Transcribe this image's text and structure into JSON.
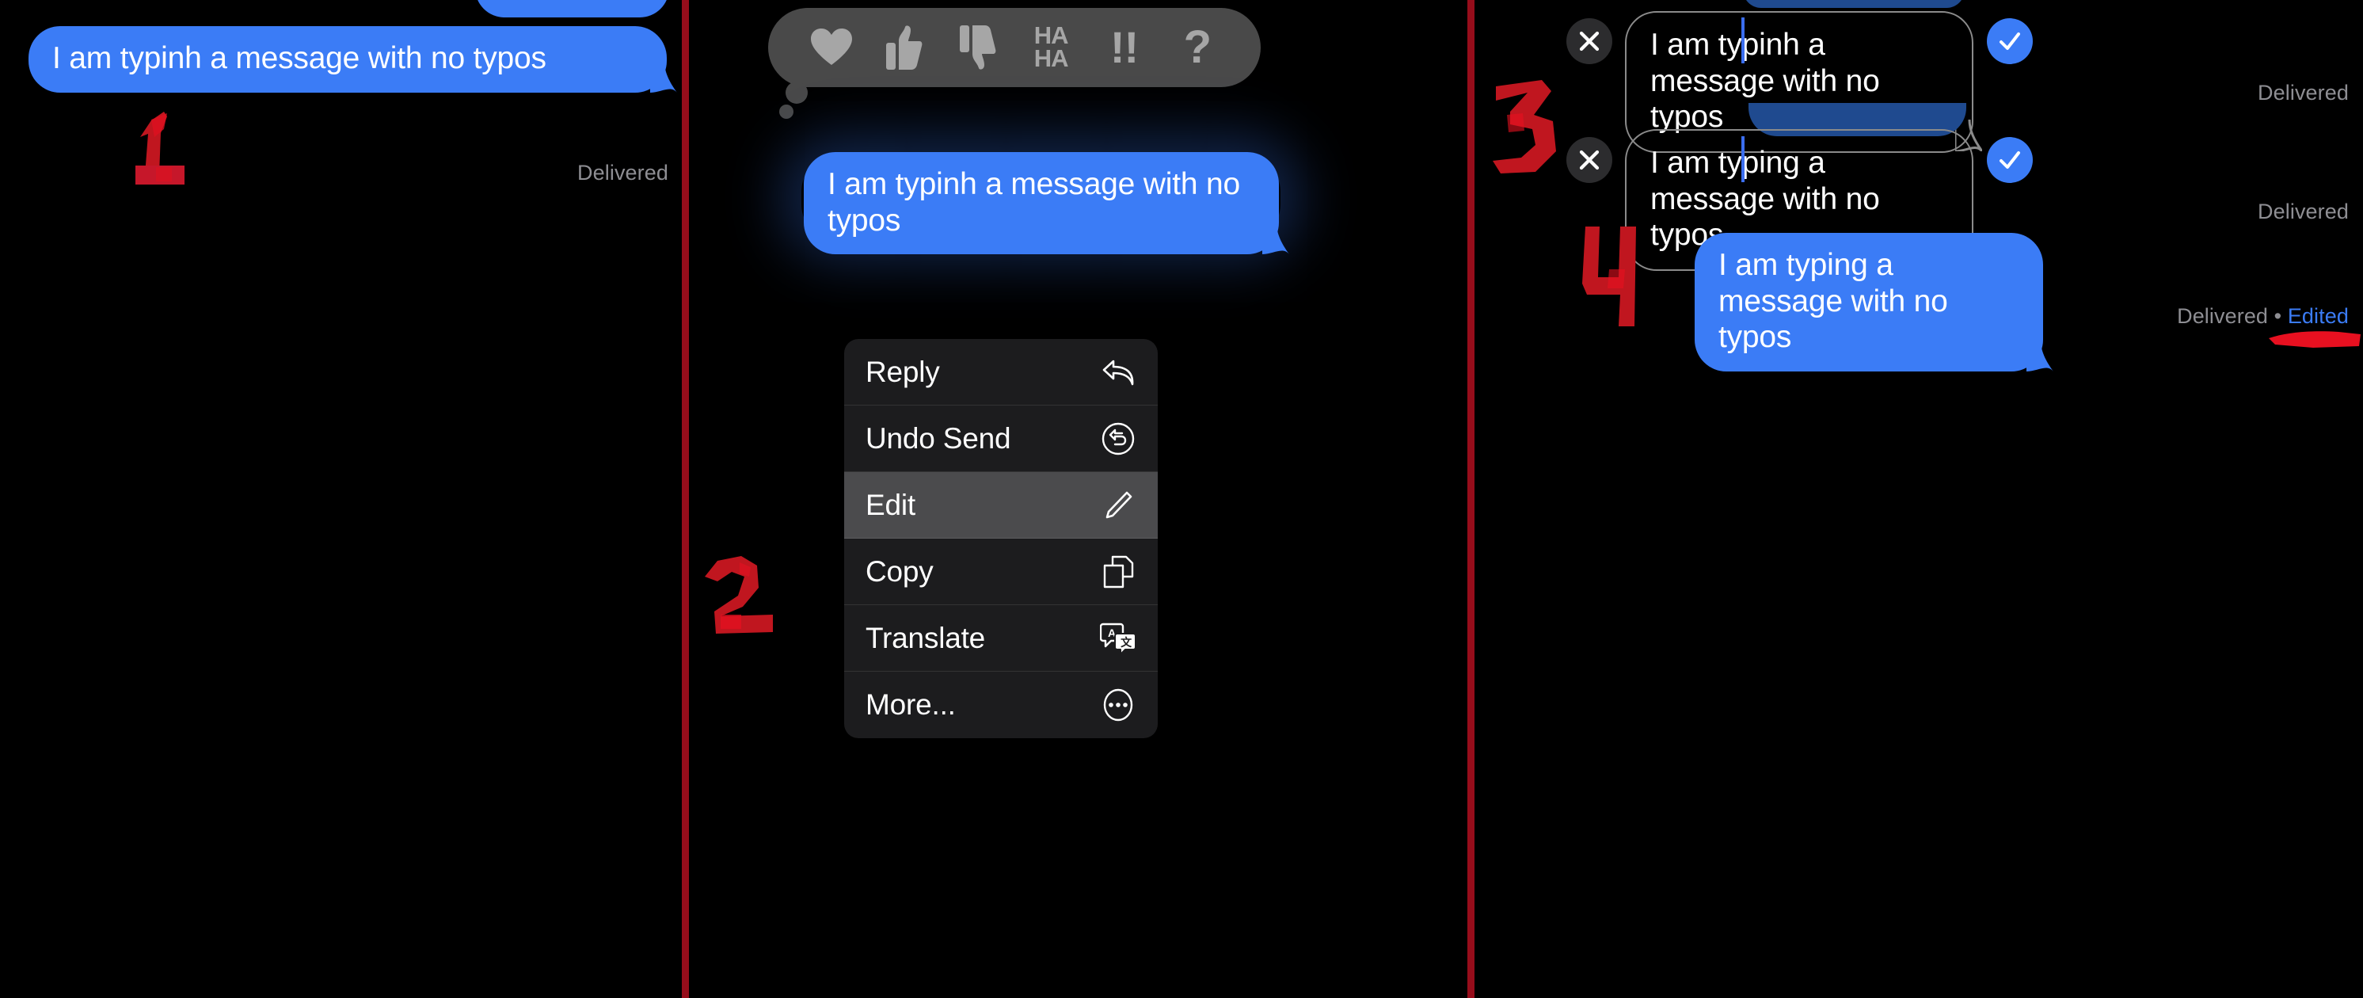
{
  "app": "iOS Messages",
  "colors": {
    "bubble_sent": "#3b7cf6",
    "bubble_sent_dim": "#1f4a8f",
    "background": "#000000",
    "status_text": "#8e8e93",
    "edited_link": "#3b7cf6",
    "menu_background": "#1c1c1e",
    "menu_highlight": "#4b4b4d",
    "reaction_bar": "#494949",
    "annotation_red": "#c0161f",
    "divider_red": "#960d1b",
    "caret_blue": "#3b6ef0"
  },
  "panels": [
    {
      "step_number": "1",
      "name": "original-message",
      "message_text": "I am typinh a message with no typos",
      "status_text": "Delivered"
    },
    {
      "step_number": "2",
      "name": "context-menu",
      "message_text": "I am typinh a message with no typos",
      "reactions": [
        {
          "name": "heart-reaction",
          "label": "Heart"
        },
        {
          "name": "thumbs-up-reaction",
          "label": "Thumbs Up"
        },
        {
          "name": "thumbs-down-reaction",
          "label": "Thumbs Down"
        },
        {
          "name": "haha-reaction",
          "label": "HA HA"
        },
        {
          "name": "exclamation-reaction",
          "label": "!!"
        },
        {
          "name": "question-reaction",
          "label": "?"
        }
      ],
      "menu_items": [
        {
          "label": "Reply",
          "icon": "reply-icon",
          "highlighted": false
        },
        {
          "label": "Undo Send",
          "icon": "undo-send-icon",
          "highlighted": false
        },
        {
          "label": "Edit",
          "icon": "pencil-icon",
          "highlighted": true
        },
        {
          "label": "Copy",
          "icon": "copy-icon",
          "highlighted": false
        },
        {
          "label": "Translate",
          "icon": "translate-icon",
          "highlighted": false
        },
        {
          "label": "More...",
          "icon": "ellipsis-icon",
          "highlighted": false
        }
      ]
    },
    {
      "step_number": "3",
      "name": "editing-message",
      "edit_before": "I am typinh a message with no typos",
      "edit_after": "I am typing a message with no typos",
      "status_text_1": "Delivered",
      "status_text_2": "Delivered",
      "cancel_label": "Cancel edit",
      "confirm_label": "Confirm edit"
    },
    {
      "step_number": "4",
      "name": "edited-result",
      "message_text": "I am typing a message with no typos",
      "status_delivered": "Delivered",
      "status_separator": "•",
      "status_edited": "Edited"
    }
  ]
}
